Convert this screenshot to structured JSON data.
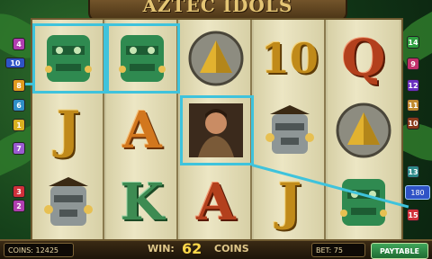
{
  "game": {
    "title": "AZTEC IDOLS"
  },
  "reels": [
    [
      "green-mask-idol",
      "J",
      "gray-mask-idol"
    ],
    [
      "green-mask-idol",
      "A",
      "K"
    ],
    [
      "pyramid-coin",
      "explorer",
      "A"
    ],
    [
      "10",
      "gray-mask-idol",
      "J"
    ],
    [
      "Q",
      "pyramid-coin",
      "green-mask-idol"
    ]
  ],
  "paylines": {
    "left": [
      "4",
      "10",
      "8",
      "6",
      "1",
      "7",
      "3",
      "2"
    ],
    "right": [
      "14",
      "9",
      "12",
      "11",
      "10",
      "13",
      "15"
    ]
  },
  "win_indicator": {
    "value": "180"
  },
  "status": {
    "coins_label": "COINS: 12425",
    "win_label": "WIN:",
    "win_value": "62",
    "win_unit": "COINS",
    "bet_label": "BET: 75",
    "paytable_label": "PAYTABLE"
  },
  "colors": {
    "winline": "#3fc3dc"
  }
}
